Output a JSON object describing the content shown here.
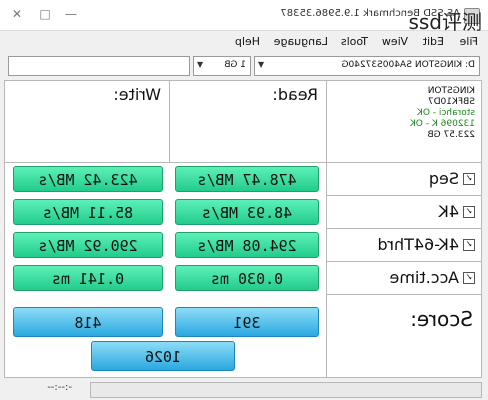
{
  "window": {
    "title": "AS SSD Benchmark 1.9.5986.35387",
    "minimize": "—",
    "maximize": "□",
    "close": "✕"
  },
  "menu": {
    "file": "File",
    "edit": "Edit",
    "view": "View",
    "tools": "Tools",
    "language": "Language",
    "help": "Help"
  },
  "toolbar": {
    "drive": "D: KINGSTON SA400S37240G",
    "size": "1 GB"
  },
  "drive_info": {
    "vendor": "KINGSTON",
    "firmware": "SBFK10D7",
    "driver": "storahci - OK",
    "alignment": "132096 K - OK",
    "capacity": "223.57 GB"
  },
  "headers": {
    "read": "Read:",
    "write": "Write:"
  },
  "rows": [
    {
      "label": "Seq",
      "read": "478.47 MB/s",
      "write": "423.42 MB/s"
    },
    {
      "label": "4K",
      "read": "48.93 MB/s",
      "write": "85.11 MB/s"
    },
    {
      "label": "4K-64Thrd",
      "read": "294.08 MB/s",
      "write": "290.92 MB/s"
    },
    {
      "label": "Acc.time",
      "read": "0.030 ms",
      "write": "0.141 ms"
    }
  ],
  "score": {
    "label": "Score:",
    "read": "391",
    "write": "418",
    "total": "1026"
  },
  "status": {
    "elapsed": "-:--:--"
  },
  "watermark": "ssd评测"
}
